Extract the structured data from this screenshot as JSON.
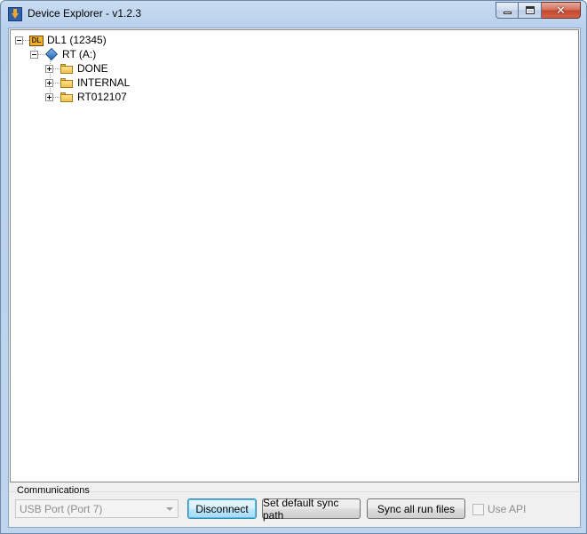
{
  "window": {
    "title": "Device Explorer - v1.2.3",
    "icons": {
      "app": "device-explorer-app-icon",
      "minimize": "minimize-icon",
      "maximize": "maximize-icon",
      "close": "close-icon"
    },
    "close_glyph": "✕"
  },
  "tree": {
    "root": {
      "label": "DL1 (12345)",
      "icon": "datalogger-icon",
      "icon_text": "DL",
      "expanded": true
    },
    "drive": {
      "label": "RT (A:)",
      "icon": "drive-icon",
      "expanded": true
    },
    "folders": [
      {
        "label": "DONE",
        "icon": "folder-icon",
        "expanded": false
      },
      {
        "label": "INTERNAL",
        "icon": "folder-icon",
        "expanded": false
      },
      {
        "label": "RT012107",
        "icon": "folder-icon",
        "expanded": false
      }
    ]
  },
  "communications": {
    "group_label": "Communications",
    "port_select": {
      "value": "USB Port (Port 7)",
      "enabled": false
    },
    "buttons": {
      "disconnect": "Disconnect",
      "set_default_sync_path": "Set default sync path",
      "sync_all_run_files": "Sync all run files"
    },
    "use_api": {
      "label": "Use API",
      "checked": false,
      "enabled": false
    }
  },
  "colors": {
    "titlebar": "#b9d1ec",
    "close_button": "#c3462f",
    "default_button_border": "#3c7fb1",
    "disabled_text": "#8d8d8d"
  }
}
